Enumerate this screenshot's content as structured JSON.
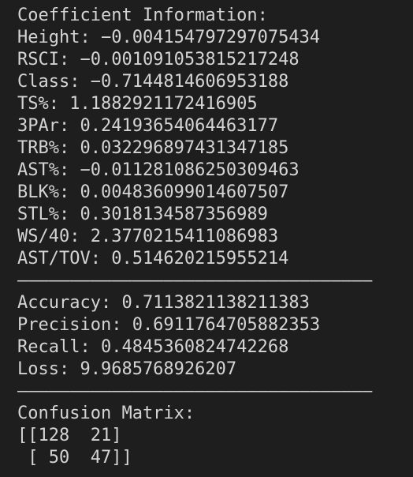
{
  "coefficients": {
    "header": "Coefficient Information:",
    "lines": [
      "Height: −0.004154797297075434",
      "RSCI: −0.001091053815217248",
      "Class: −0.7144814606953188",
      "TS%: 1.1882921172416905",
      "3PAr: 0.24193654064463177",
      "TRB%: 0.032296897431347185",
      "AST%: −0.011281086250309463",
      "BLK%: 0.004836099014607507",
      "STL%: 0.3018134587356989",
      "WS/40: 2.3770215411086983",
      "AST/TOV: 0.514620215955214"
    ]
  },
  "divider_1": "——————————————————————————————————",
  "metrics": {
    "accuracy": "Accuracy: 0.7113821138211383",
    "precision": "Precision: 0.6911764705882353",
    "recall": "Recall: 0.4845360824742268",
    "loss": "Loss: 9.9685768926207"
  },
  "divider_2": "——————————————————————————————————",
  "confusion": {
    "header": "Confusion Matrix:",
    "row_1": "[[128  21]",
    "row_2": " [ 50  47]]"
  }
}
